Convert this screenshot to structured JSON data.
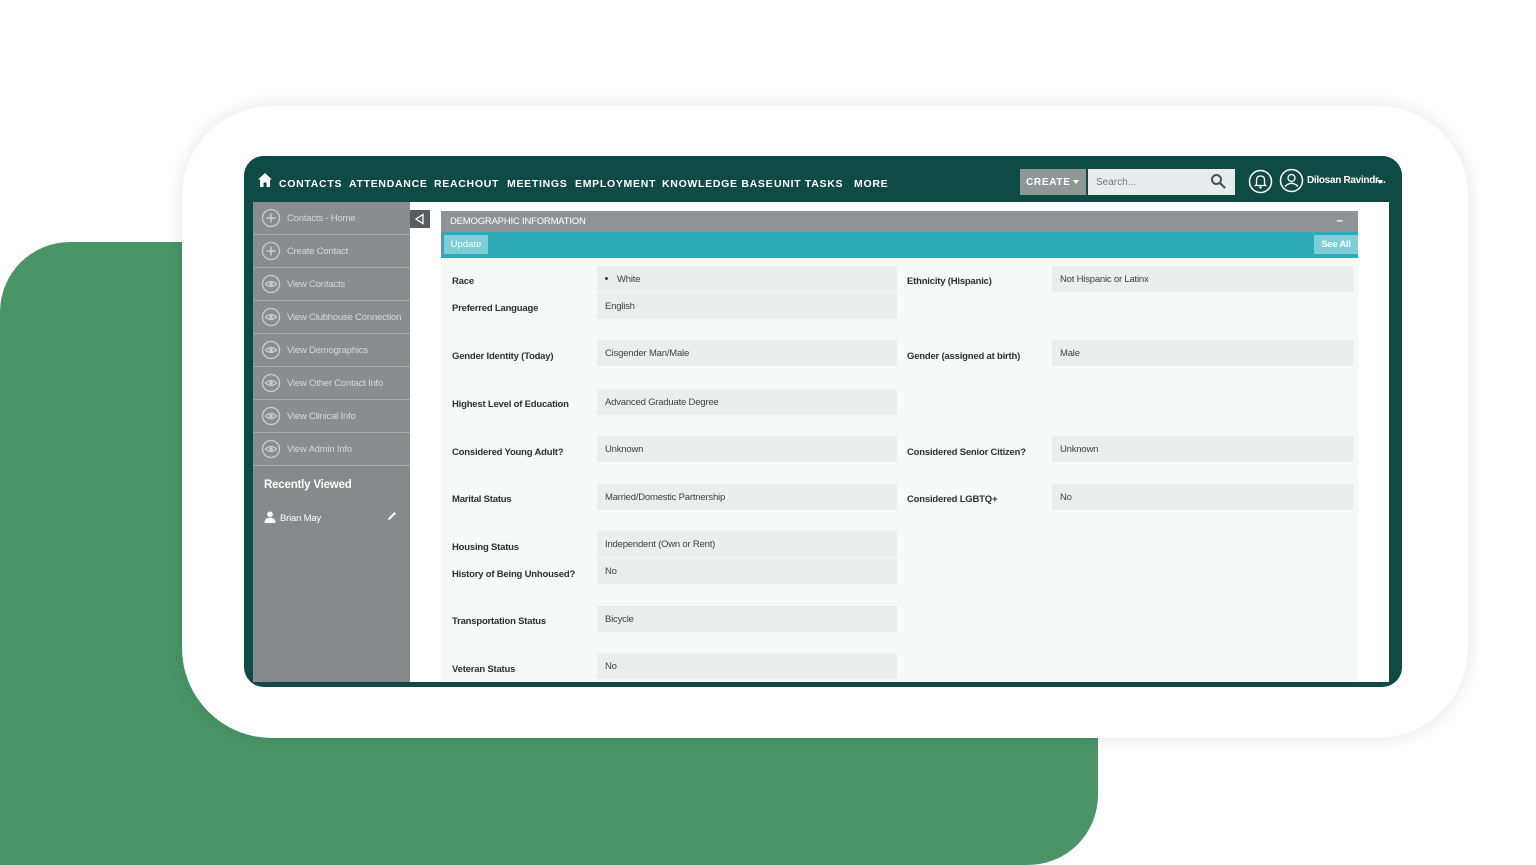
{
  "nav": {
    "items": [
      "CONTACTS",
      "ATTENDANCE",
      "REACHOUT",
      "MEETINGS",
      "EMPLOYMENT",
      "KNOWLEDGE BASE",
      "UNIT TASKS",
      "MORE"
    ],
    "create_label": "CREATE",
    "search_placeholder": "Search...",
    "user_name": "Dilosan Ravindr..."
  },
  "sidebar": {
    "items": [
      {
        "label": "Contacts - Home",
        "icon": "plus-circle-icon"
      },
      {
        "label": "Create Contact",
        "icon": "plus-circle-icon"
      },
      {
        "label": "View Contacts",
        "icon": "eye-icon"
      },
      {
        "label": "View Clubhouse Connection",
        "icon": "eye-icon"
      },
      {
        "label": "View Demographics",
        "icon": "eye-icon"
      },
      {
        "label": "View Other Contact Info",
        "icon": "eye-icon"
      },
      {
        "label": "View Clinical Info",
        "icon": "eye-icon"
      },
      {
        "label": "View Admin Info",
        "icon": "eye-icon"
      }
    ],
    "recently_viewed_title": "Recently Viewed",
    "recent_items": [
      "Brian May"
    ]
  },
  "panel": {
    "title": "DEMOGRAPHIC INFORMATION",
    "minimize_label": "–",
    "update_label": "Update",
    "see_all_label": "See All"
  },
  "fields": {
    "race": {
      "label": "Race",
      "value": "White"
    },
    "ethnicity": {
      "label": "Ethnicity (Hispanic)",
      "value": "Not Hispanic or Latinx"
    },
    "language": {
      "label": "Preferred Language",
      "value": "English"
    },
    "gender_identity": {
      "label": "Gender Identity (Today)",
      "value": "Cisgender Man/Male"
    },
    "gender_birth": {
      "label": "Gender (assigned at birth)",
      "value": "Male"
    },
    "education": {
      "label": "Highest Level of Education",
      "value": "Advanced Graduate Degree"
    },
    "young_adult": {
      "label": "Considered Young Adult?",
      "value": "Unknown"
    },
    "senior": {
      "label": "Considered Senior Citizen?",
      "value": "Unknown"
    },
    "marital": {
      "label": "Marital Status",
      "value": "Married/Domestic Partnership"
    },
    "lgbtq": {
      "label": "Considered LGBTQ+",
      "value": "No"
    },
    "housing": {
      "label": "Housing Status",
      "value": "Independent (Own or Rent)"
    },
    "unhoused": {
      "label": "History of Being Unhoused?",
      "value": "No"
    },
    "transportation": {
      "label": "Transportation Status",
      "value": "Bicycle"
    },
    "veteran": {
      "label": "Veteran Status",
      "value": "No"
    }
  },
  "colors": {
    "nav_bg": "#0f4a45",
    "accent": "#2ea9b7",
    "background_blob": "#4a9467",
    "sidebar_bg": "#868a8c"
  }
}
